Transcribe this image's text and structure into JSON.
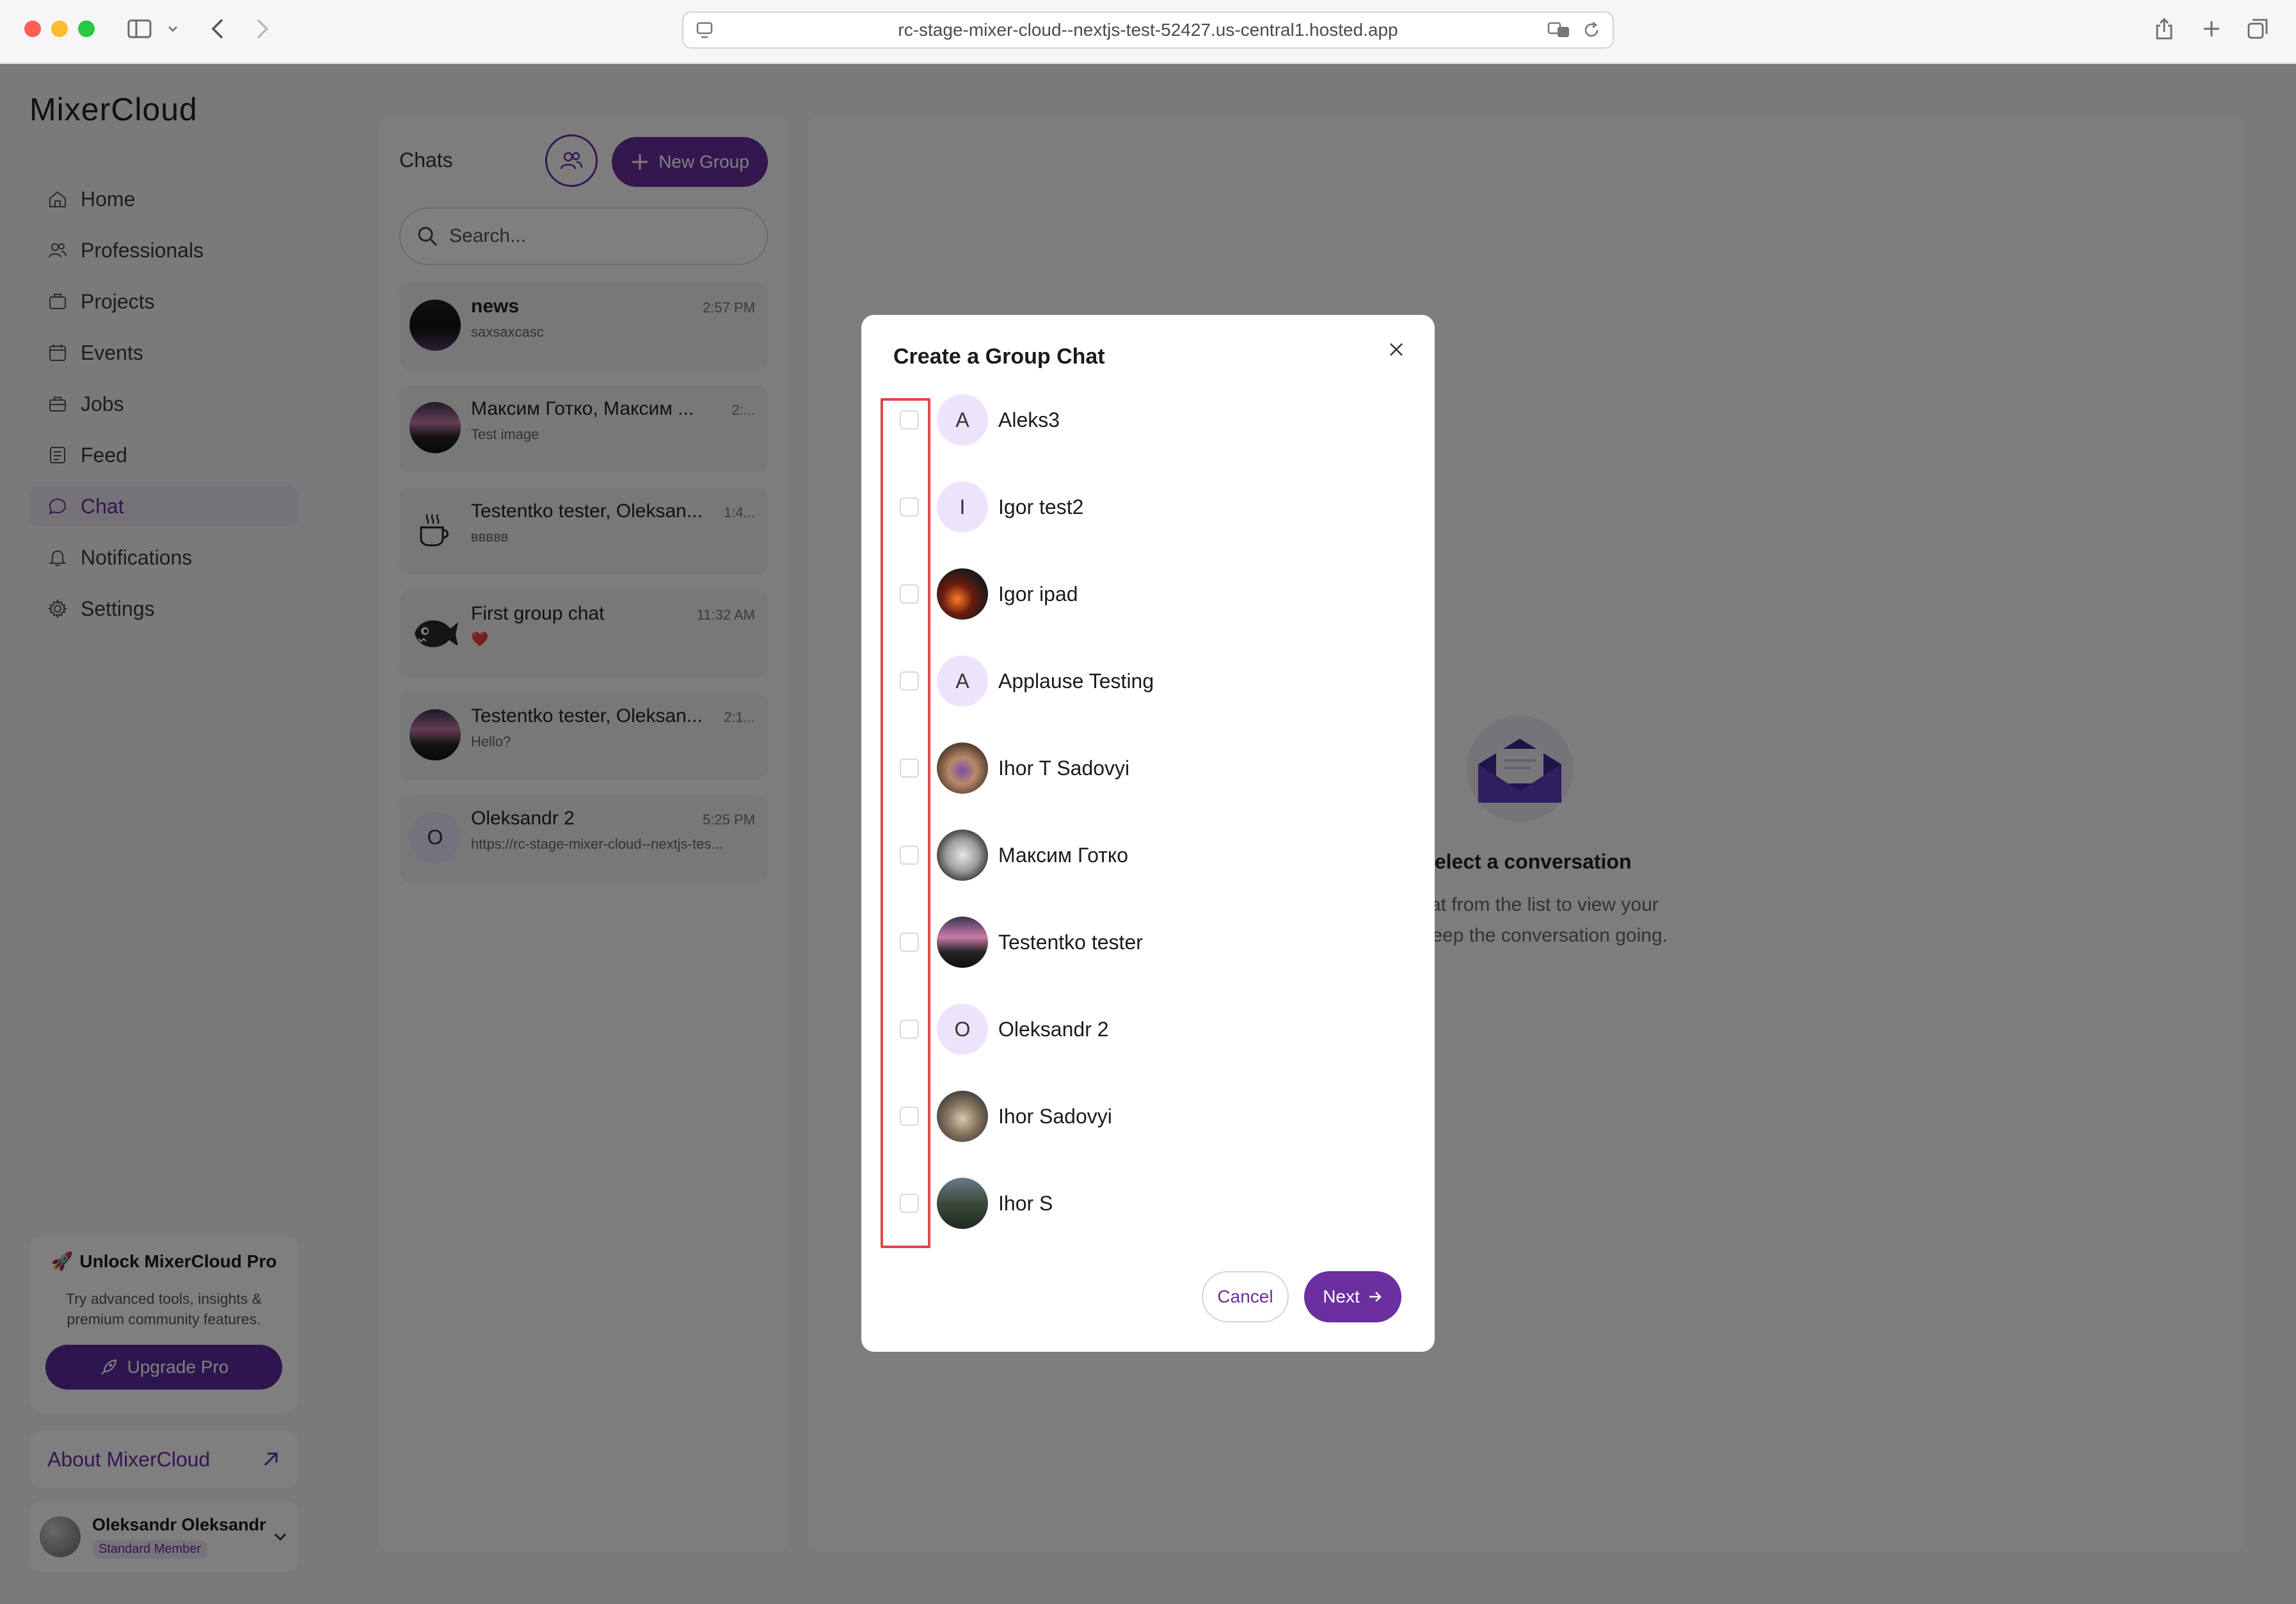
{
  "browser": {
    "url": "rc-stage-mixer-cloud--nextjs-test-52427.us-central1.hosted.app"
  },
  "app": {
    "brand": "MixerCloud",
    "nav": [
      {
        "label": "Home",
        "icon": "home-icon",
        "active": false
      },
      {
        "label": "Professionals",
        "icon": "people-icon",
        "active": false
      },
      {
        "label": "Projects",
        "icon": "briefcase-icon",
        "active": false
      },
      {
        "label": "Events",
        "icon": "calendar-icon",
        "active": false
      },
      {
        "label": "Jobs",
        "icon": "bag-icon",
        "active": false
      },
      {
        "label": "Feed",
        "icon": "feed-icon",
        "active": false
      },
      {
        "label": "Chat",
        "icon": "chat-icon",
        "active": true
      },
      {
        "label": "Notifications",
        "icon": "bell-icon",
        "active": false
      },
      {
        "label": "Settings",
        "icon": "gear-icon",
        "active": false
      }
    ],
    "promo": {
      "title": "Unlock MixerCloud Pro",
      "text_line1": "Try advanced tools, insights &",
      "text_line2": "premium community features.",
      "button": "Upgrade Pro"
    },
    "about": "About MixerCloud",
    "user": {
      "name": "Oleksandr Oleksandr",
      "badge": "Standard Member"
    }
  },
  "chats": {
    "title": "Chats",
    "new_group": "New Group",
    "search_placeholder": "Search...",
    "items": [
      {
        "name": "news",
        "time": "2:57 PM",
        "sub": "saxsaxcasc"
      },
      {
        "name": "Максим Готко, Максим ...",
        "time": "2:...",
        "sub": "Test image"
      },
      {
        "name": "Testentko tester, Oleksan...",
        "time": "1:4...",
        "sub": "ввввв"
      },
      {
        "name": "First group chat",
        "time": "11:32 AM",
        "sub": "❤️"
      },
      {
        "name": "Testentko tester, Oleksan...",
        "time": "2:1...",
        "sub": "Hello?"
      },
      {
        "name": "Oleksandr 2",
        "time": "5:25 PM",
        "sub": "https://rc-stage-mixer-cloud--nextjs-tes...",
        "letter": "O"
      }
    ]
  },
  "empty_state": {
    "title": "Select a conversation",
    "line1": "a chat from the list to view your",
    "line2": "and keep the conversation going."
  },
  "modal": {
    "title": "Create a Group Chat",
    "members": [
      {
        "name": "Aleks3",
        "letter": "A",
        "checked": false
      },
      {
        "name": "Igor test2",
        "letter": "I",
        "checked": false
      },
      {
        "name": "Igor ipad",
        "letter": "",
        "checked": false
      },
      {
        "name": "Applause Testing",
        "letter": "A",
        "checked": false
      },
      {
        "name": "Ihor T Sadovyi",
        "letter": "",
        "checked": false
      },
      {
        "name": "Максим Готко",
        "letter": "",
        "checked": false
      },
      {
        "name": "Testentko tester",
        "letter": "",
        "checked": false
      },
      {
        "name": "Oleksandr 2",
        "letter": "O",
        "checked": false
      },
      {
        "name": "Ihor Sadovyi",
        "letter": "",
        "checked": false
      },
      {
        "name": "Ihor S",
        "letter": "",
        "checked": false
      }
    ],
    "cancel": "Cancel",
    "next": "Next"
  },
  "colors": {
    "accent": "#6b2fa0",
    "highlight": "#e0464a"
  }
}
